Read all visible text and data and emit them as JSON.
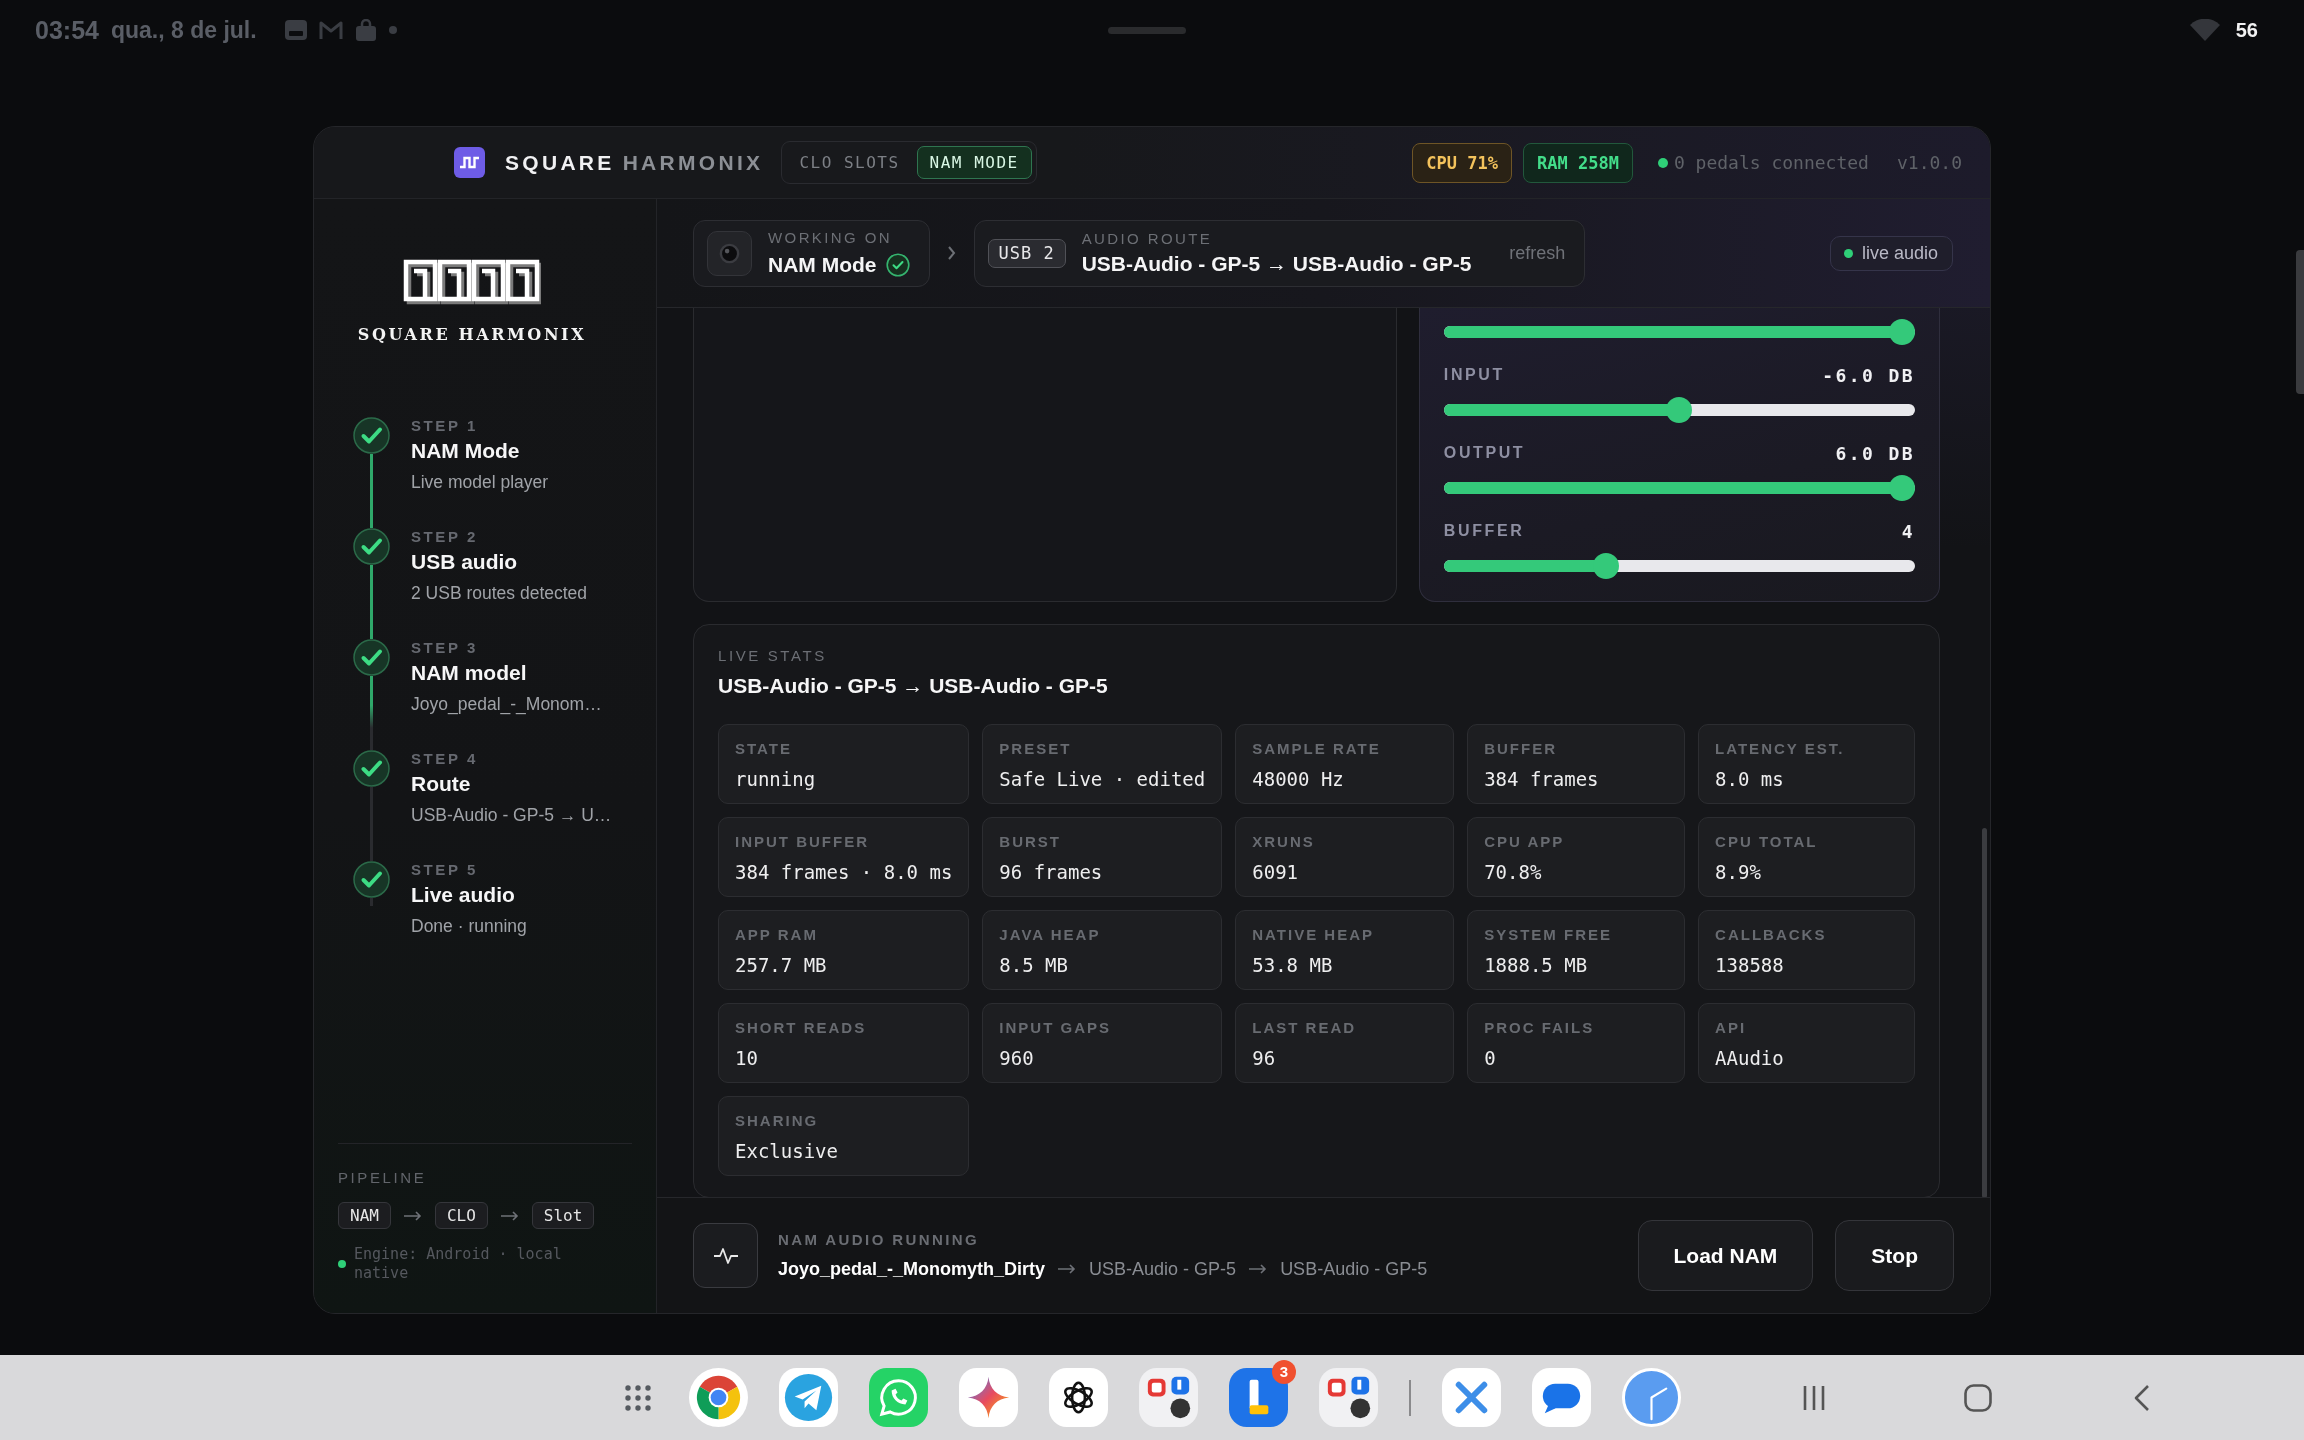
{
  "status_bar": {
    "time": "03:54",
    "date": "qua., 8 de jul.",
    "battery": "56"
  },
  "header": {
    "brand": {
      "name": "SQUARE",
      "suffix": "HARMONIX"
    },
    "tabs": [
      {
        "label": "CLO SLOTS",
        "selected": false
      },
      {
        "label": "NAM MODE",
        "selected": true
      }
    ],
    "badges": [
      {
        "kind": "cpu",
        "label": "CPU 71%"
      },
      {
        "kind": "ram",
        "label": "RAM 258M"
      }
    ],
    "connection": "0 pedals connected",
    "version": "v1.0.0"
  },
  "sidebar": {
    "brand": "SQUARE HARMONIX",
    "steps": [
      {
        "step": "STEP 1",
        "title": "NAM Mode",
        "detail": "Live model player",
        "done": true
      },
      {
        "step": "STEP 2",
        "title": "USB audio",
        "detail": "2 USB routes detected",
        "done": true
      },
      {
        "step": "STEP 3",
        "title": "NAM model",
        "detail": "Joyo_pedal_-_Monom…",
        "done": true
      },
      {
        "step": "STEP 4",
        "title": "Route",
        "detail": "USB-Audio - GP-5 → U…",
        "done": true
      },
      {
        "step": "STEP 5",
        "title": "Live audio",
        "detail": "Done · running",
        "done": true
      }
    ],
    "pipeline": {
      "title": "PIPELINE",
      "chips": [
        "NAM",
        "CLO",
        "Slot"
      ],
      "engine": "Engine: Android · local native"
    }
  },
  "context_bar": {
    "working_on": {
      "label": "WORKING ON",
      "value": "NAM Mode"
    },
    "route": {
      "chip": "USB 2",
      "label": "AUDIO ROUTE",
      "value": "USB-Audio - GP-5 → USB-Audio - GP-5",
      "action": "refresh"
    },
    "live_badge": "live audio"
  },
  "controls": {
    "sliders": [
      {
        "level": 1
      },
      {
        "label": "INPUT",
        "reading": "-6.0 DB",
        "level": 0.5
      },
      {
        "label": "OUTPUT",
        "reading": "6.0 DB",
        "level": 1
      },
      {
        "label": "BUFFER",
        "reading": "4",
        "level": 0.335
      }
    ]
  },
  "live_stats": {
    "label": "LIVE STATS",
    "title": "USB-Audio - GP-5 → USB-Audio - GP-5",
    "stats": [
      {
        "label": "STATE",
        "value": "running"
      },
      {
        "label": "PRESET",
        "value": "Safe Live · edited"
      },
      {
        "label": "SAMPLE RATE",
        "value": "48000 Hz"
      },
      {
        "label": "BUFFER",
        "value": "384 frames"
      },
      {
        "label": "LATENCY EST.",
        "value": "8.0 ms"
      },
      {
        "label": "INPUT BUFFER",
        "value": "384 frames · 8.0 ms"
      },
      {
        "label": "BURST",
        "value": "96 frames"
      },
      {
        "label": "XRUNS",
        "value": "6091"
      },
      {
        "label": "CPU APP",
        "value": "70.8%"
      },
      {
        "label": "CPU TOTAL",
        "value": "8.9%"
      },
      {
        "label": "APP RAM",
        "value": "257.7 MB"
      },
      {
        "label": "JAVA HEAP",
        "value": "8.5 MB"
      },
      {
        "label": "NATIVE HEAP",
        "value": "53.8 MB"
      },
      {
        "label": "SYSTEM FREE",
        "value": "1888.5 MB"
      },
      {
        "label": "CALLBACKS",
        "value": "138588"
      },
      {
        "label": "SHORT READS",
        "value": "10"
      },
      {
        "label": "INPUT GAPS",
        "value": "960"
      },
      {
        "label": "LAST READ",
        "value": "96"
      },
      {
        "label": "PROC FAILS",
        "value": "0"
      },
      {
        "label": "API",
        "value": "AAudio"
      },
      {
        "label": "SHARING",
        "value": "Exclusive"
      }
    ]
  },
  "now_playing": {
    "label": "NAM AUDIO RUNNING",
    "model": "Joyo_pedal_-_Monomyth_Dirty",
    "route": [
      "USB-Audio - GP-5",
      "USB-Audio - GP-5"
    ],
    "buttons": [
      "Load NAM",
      "Stop"
    ]
  },
  "taskbar": {
    "badge": "3"
  }
}
